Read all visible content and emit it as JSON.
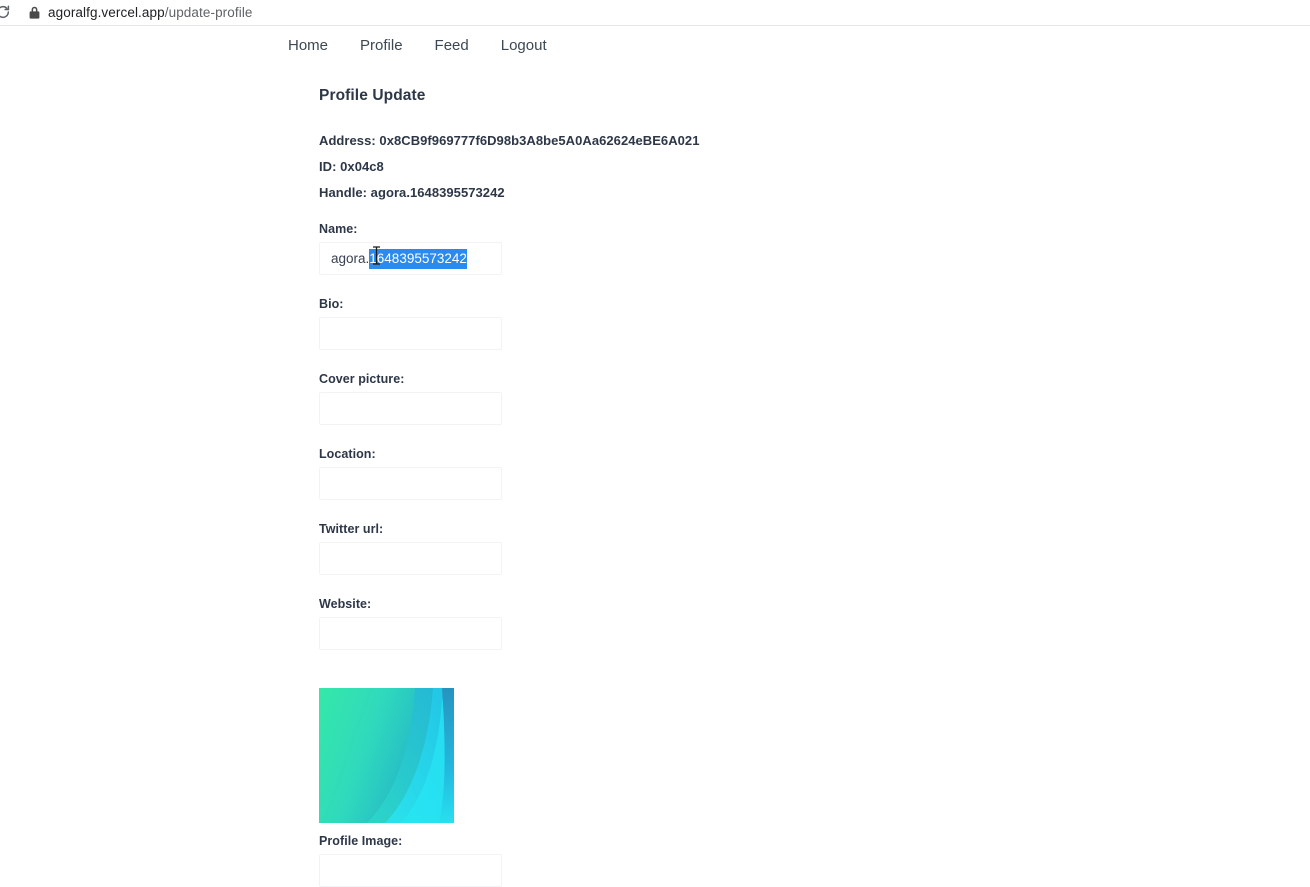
{
  "browser": {
    "reload_icon": "reload-icon",
    "lock_icon": "lock-icon",
    "url_host": "agoralfg.vercel.app",
    "url_path": "/update-profile",
    "url_full": "agoralfg.vercel.app/update-profile"
  },
  "nav": {
    "items": [
      {
        "label": "Home"
      },
      {
        "label": "Profile"
      },
      {
        "label": "Feed"
      },
      {
        "label": "Logout"
      }
    ]
  },
  "page": {
    "title": "Profile Update",
    "info": [
      {
        "label": "Address:",
        "value": "0x8CB9f969777f6D98b3A8be5A0Aa62624eBE6A021",
        "text": "Address: 0x8CB9f969777f6D98b3A8be5A0Aa62624eBE6A021"
      },
      {
        "label": "ID:",
        "value": "0x04c8",
        "text": "ID: 0x04c8"
      },
      {
        "label": "Handle:",
        "value": "agora.1648395573242",
        "text": "Handle: agora.1648395573242"
      }
    ]
  },
  "form": {
    "name": {
      "label": "Name:",
      "value": "agora.1648395573242",
      "value_unselected": "agora.",
      "value_selected": "1648395573242",
      "placeholder": "",
      "selection_color": "#2a8af0"
    },
    "fields": [
      {
        "name": "bio",
        "label": "Bio:",
        "value": "",
        "placeholder": ""
      },
      {
        "name": "cover-picture",
        "label": "Cover picture:",
        "value": "",
        "placeholder": ""
      },
      {
        "name": "location",
        "label": "Location:",
        "value": "",
        "placeholder": ""
      },
      {
        "name": "twitter-url",
        "label": "Twitter url:",
        "value": "",
        "placeholder": ""
      },
      {
        "name": "website",
        "label": "Website:",
        "value": "",
        "placeholder": ""
      }
    ],
    "profile_image": {
      "label": "Profile Image:",
      "value": "",
      "placeholder": ""
    }
  },
  "preview": {
    "name": "cover-image-preview",
    "colors": {
      "top_left": "#35e8a8",
      "bottom_left": "#3aeca8",
      "top_right": "#2b9fc4",
      "bottom_right": "#25e0f0",
      "mid": "#2ad0cf"
    }
  },
  "theme": {
    "page_background": "#ffffff",
    "text_color": "#2d3748",
    "nav_color": "#3d4852",
    "input_border": "#f2f3f5",
    "chrome_border": "#e6e6e6"
  }
}
